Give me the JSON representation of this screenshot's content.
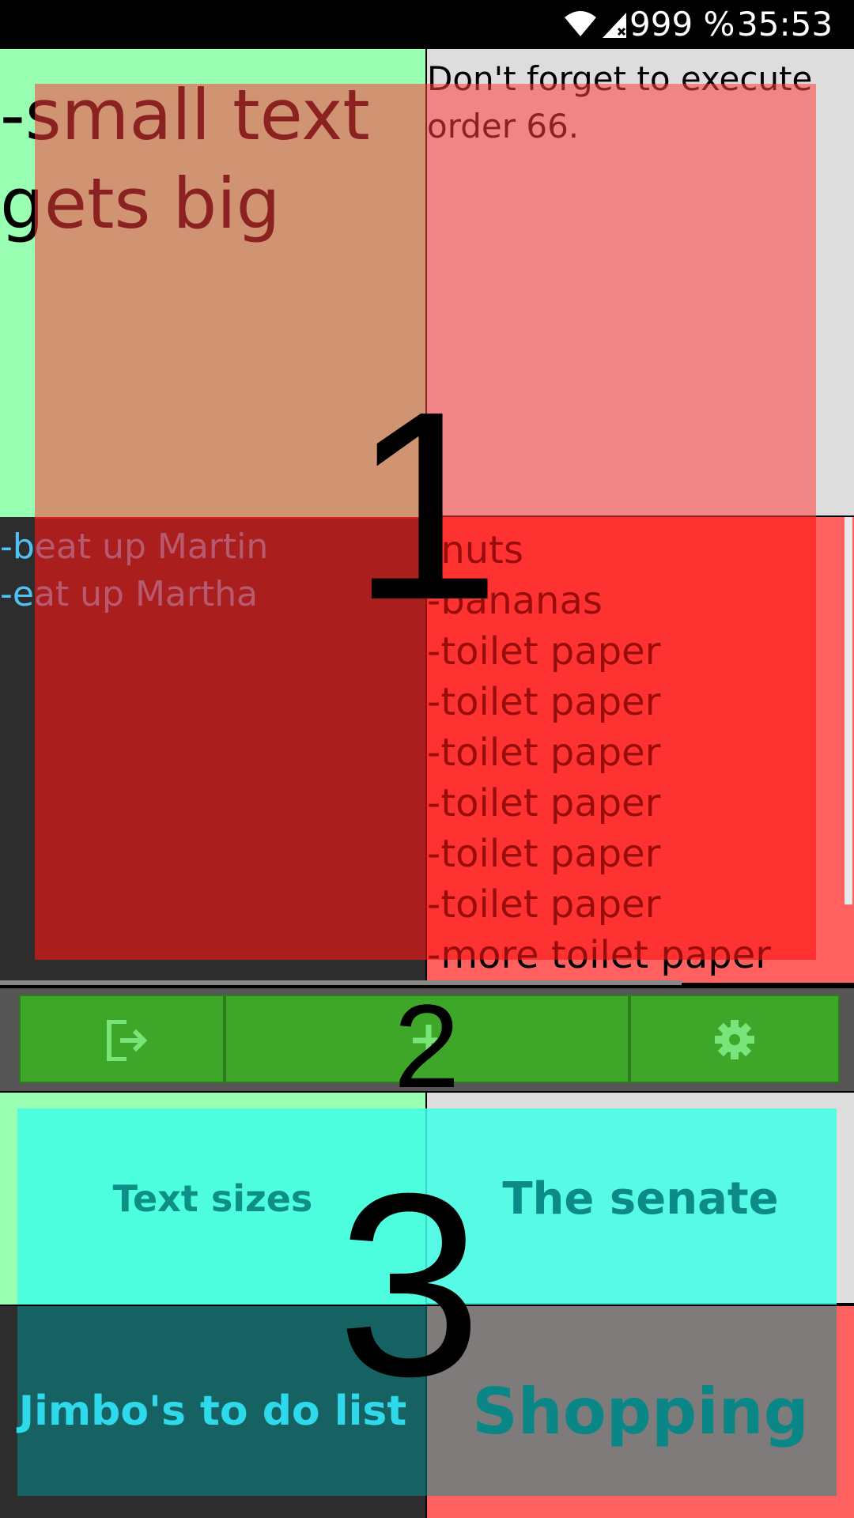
{
  "status_bar": {
    "battery": "999 %",
    "time": "35:53",
    "wifi_icon": "wifi-icon",
    "signal_icon": "signal-no-data-icon"
  },
  "notes": [
    {
      "text": "-small text\ngets big",
      "bg": "#99ffb3",
      "text_color": "#000000"
    },
    {
      "text": "Don't forget to execute\norder 66.",
      "bg": "#dddddd",
      "text_color": "#000000"
    },
    {
      "text": "-beat up Martin\n-eat up Martha",
      "bg": "#2d2d2d",
      "text_color": "#4fc3f7"
    },
    {
      "text": "-nuts\n-bananas\n-toilet paper\n-toilet paper\n-toilet paper\n-toilet paper\n-toilet paper\n-toilet paper\n-more toilet paper",
      "bg": "#ff6060",
      "text_color": "#000000"
    }
  ],
  "toolbar": {
    "logout_icon": "logout-icon",
    "add_icon": "add-icon",
    "settings_icon": "gear-icon",
    "accent": "#3ea729"
  },
  "categories": [
    {
      "label": "Text sizes",
      "bg": "#99ffb3"
    },
    {
      "label": "The senate",
      "bg": "#dddddd"
    },
    {
      "label": "Jimbo's to do list",
      "bg": "#2d2d2d"
    },
    {
      "label": "Shopping",
      "bg": "#ff6060"
    }
  ],
  "overlay_labels": {
    "region_1": "1",
    "region_2": "2",
    "region_3": "3"
  }
}
